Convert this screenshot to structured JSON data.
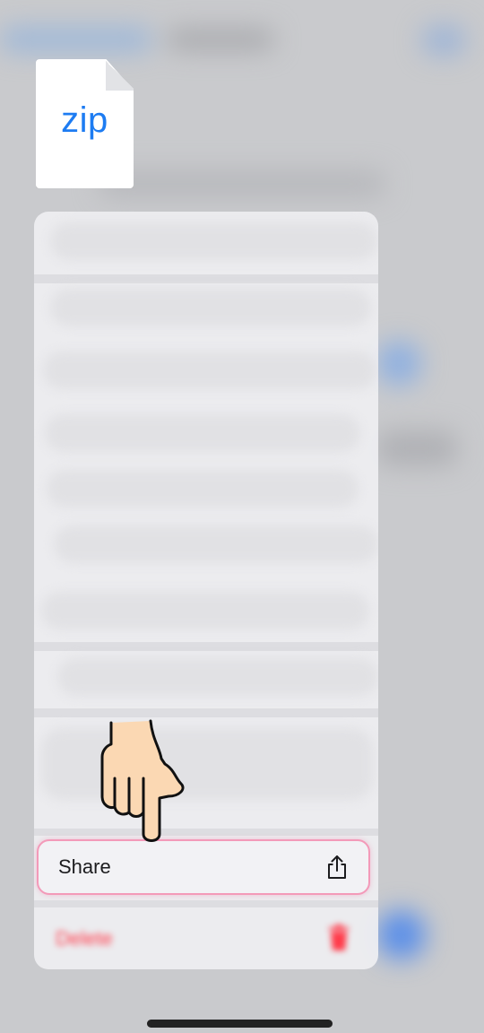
{
  "file": {
    "type_label": "zip"
  },
  "menu": {
    "share": {
      "label": "Share",
      "icon": "share-icon"
    },
    "delete": {
      "label": "Delete",
      "icon": "trash-icon"
    }
  },
  "colors": {
    "accent": "#1d7cf2",
    "destructive": "#ff3b4a",
    "highlight": "#f39ab9"
  }
}
